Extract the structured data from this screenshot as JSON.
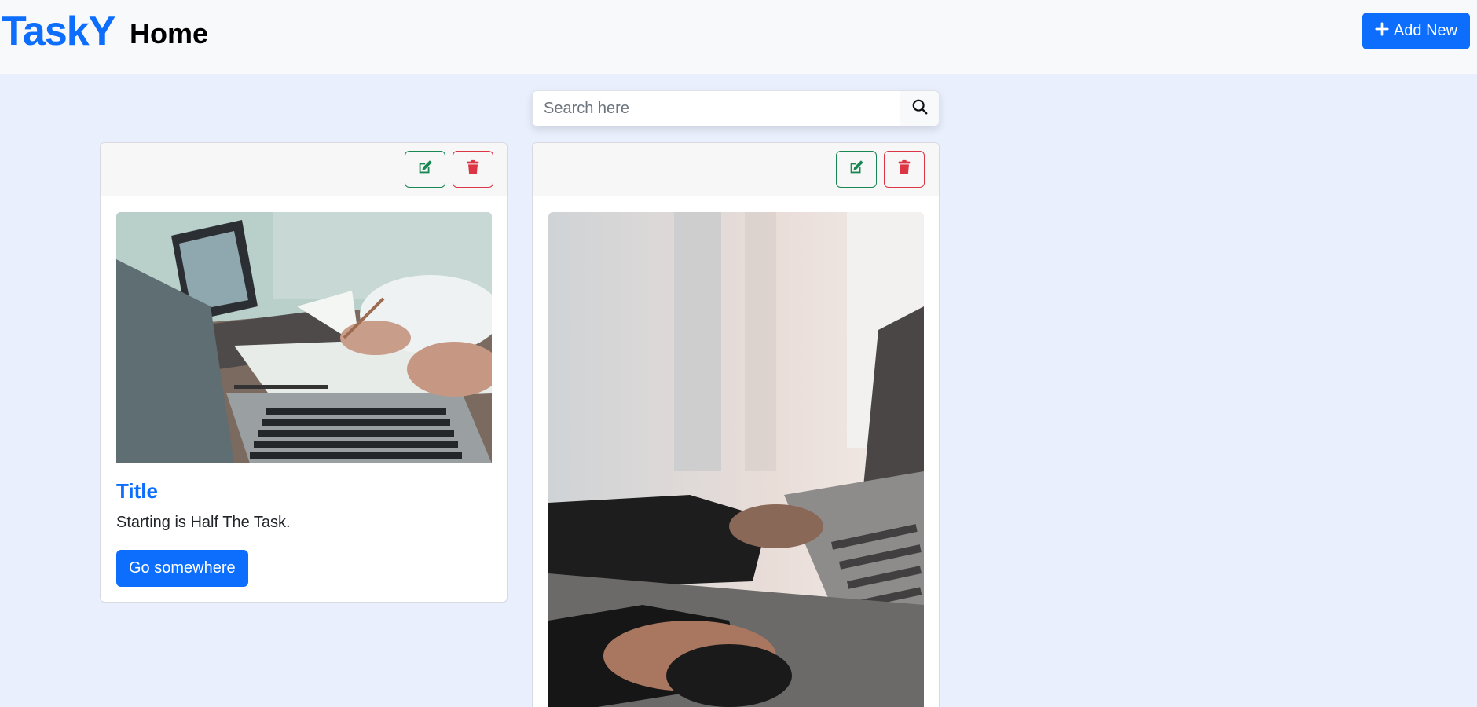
{
  "navbar": {
    "brand": "TaskY",
    "home_label": "Home",
    "add_button_label": "Add New"
  },
  "search": {
    "placeholder": "Search here",
    "value": ""
  },
  "cards": [
    {
      "title": "Title",
      "text": "Starting is Half The Task.",
      "button_label": "Go somewhere",
      "image_desc": "laptops-meeting-photo"
    },
    {
      "image_desc": "hand-on-mouse-laptop-photo"
    }
  ],
  "colors": {
    "primary": "#0d6efd",
    "success": "#198754",
    "danger": "#dc3545",
    "page_bg": "#e9effd",
    "navbar_bg": "#f8f9fa"
  },
  "icons": {
    "add": "plus-icon",
    "search": "magnifier-icon",
    "edit": "pencil-square-icon",
    "delete": "trash-icon"
  }
}
